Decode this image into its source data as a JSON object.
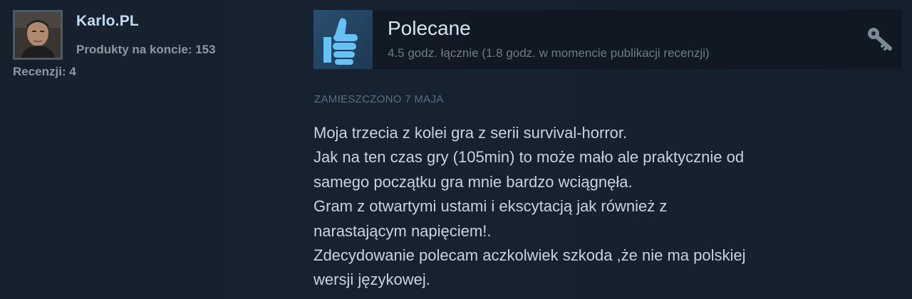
{
  "author": {
    "name": "Karlo.PL",
    "products_label": "Produkty na koncie: 153",
    "reviews_label": "Recenzji: 4"
  },
  "verdict": {
    "title": "Polecane",
    "hours": "4.5 godz. łącznie (1.8 godz. w momencie publikacji recenzji)",
    "icon": "thumbs-up-icon",
    "badge_icon": "key-icon"
  },
  "posted": "ZAMIESZCZONO 7 MAJA",
  "review": {
    "lines": [
      "Moja trzecia z kolei gra z serii survival-horror.",
      "Jak na ten czas gry (105min) to może mało ale praktycznie od",
      "samego początku gra mnie bardzo wciągnęła.",
      "Gram z otwartymi ustami i ekscytacją jak również z",
      "narastającym napięciem!.",
      "Zdecydowanie polecam aczkolwiek szkoda ,że nie ma polskiej",
      "wersji językowej."
    ]
  },
  "colors": {
    "background": "#1b2838",
    "author_name": "#c1dbf4",
    "thumb_up": "#67c1f5",
    "muted": "#8f98a0"
  }
}
